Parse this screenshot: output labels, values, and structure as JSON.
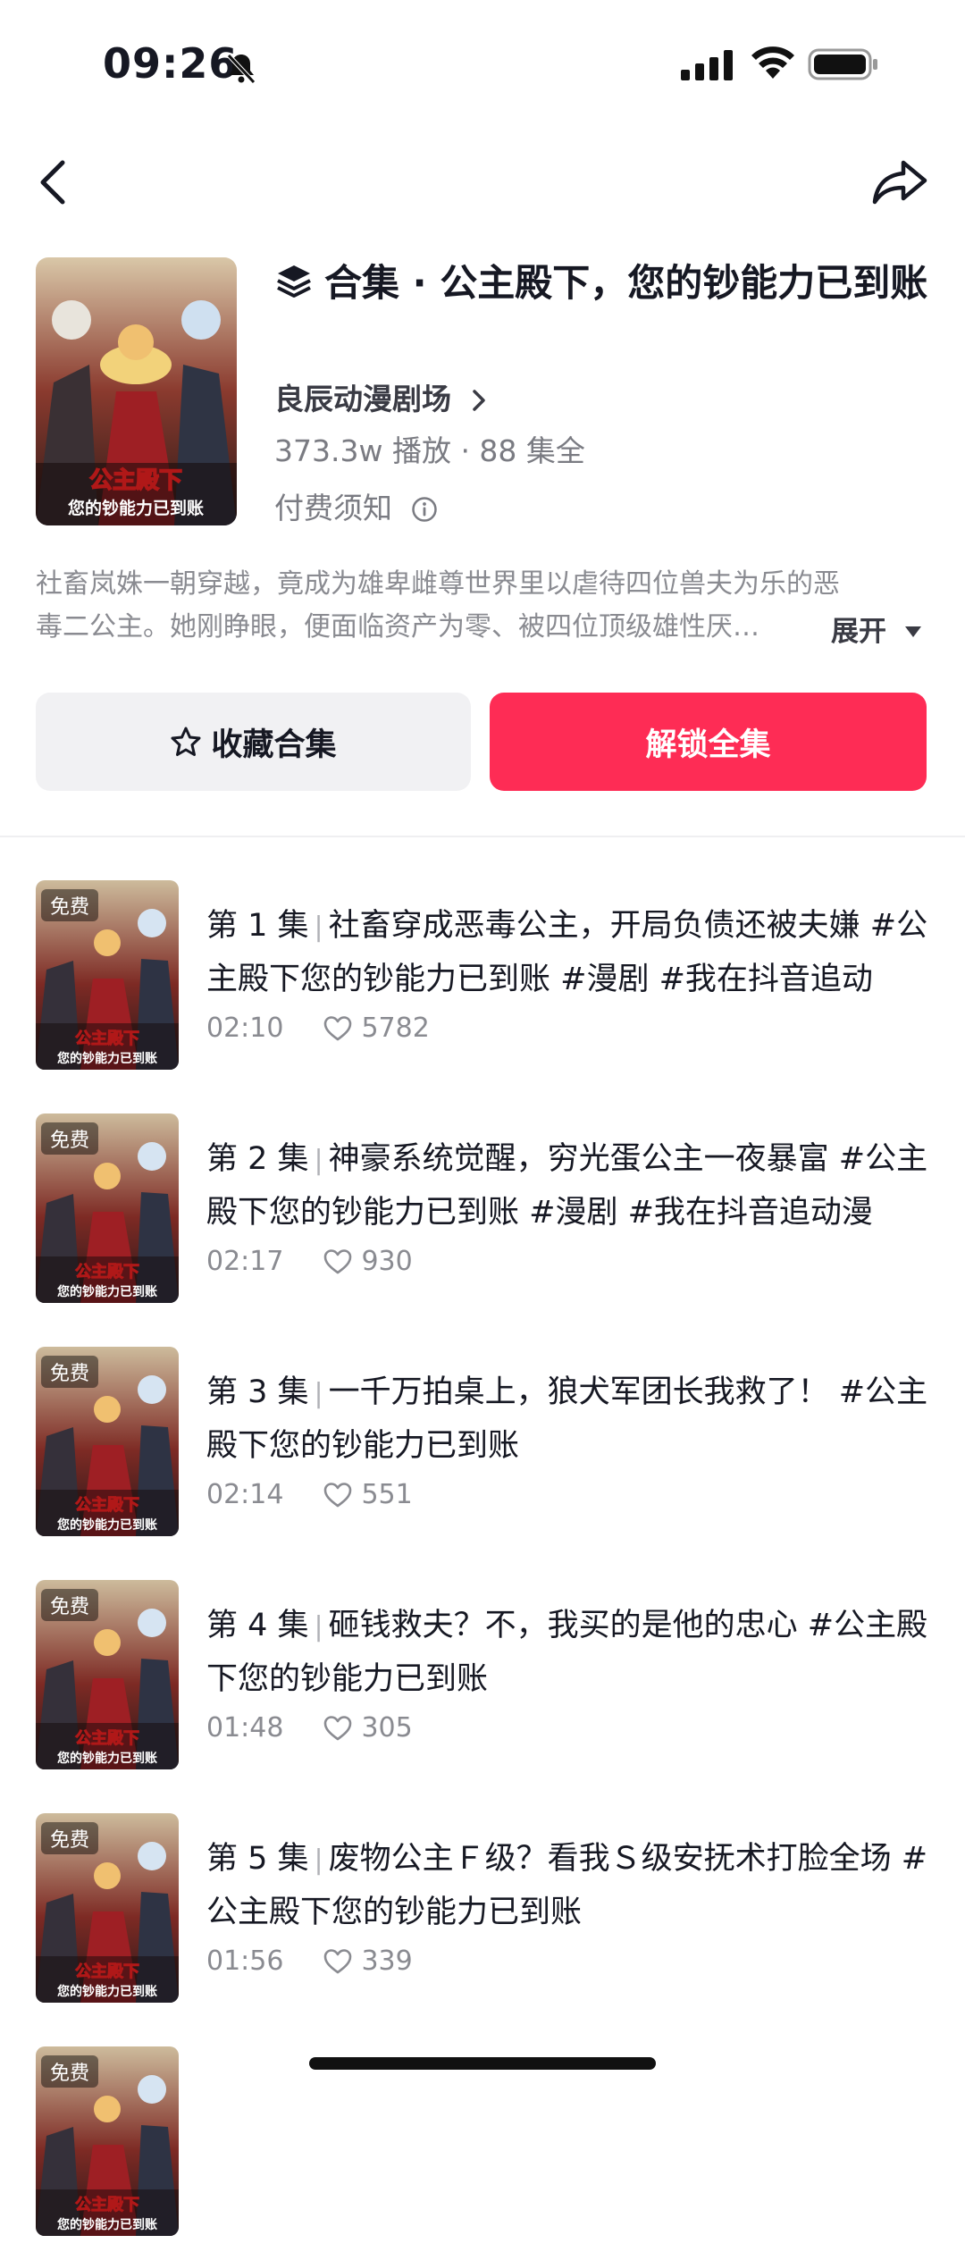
{
  "status_bar": {
    "time": "09:26"
  },
  "collection": {
    "title": "合集 · 公主殿下，您的钞能力已到账",
    "channel": "良辰动漫剧场",
    "stats": "373.3w 播放 · 88 集全",
    "pay_note": "付费须知",
    "description_line1": "社畜岚姝一朝穿越，竟成为雄卑雌尊世界里以虐待四位兽夫为乐的恶",
    "description_line2": "毒二公主。她刚睁眼，便面临资产为零、被四位顶级雄性厌…",
    "expand_label": "展开",
    "cover_text_line1": "公主殿下",
    "cover_text_line2": "您的钞能力已到账"
  },
  "actions": {
    "favorite_label": "收藏合集",
    "unlock_label": "解锁全集"
  },
  "episodes": [
    {
      "badge": "免费",
      "number": "第 1 集",
      "title": "社畜穿成恶毒公主，开局负债还被夫嫌 #公主殿下您的钞能力已到账 #漫剧 #我在抖音追动",
      "duration": "02:10",
      "likes": "5782"
    },
    {
      "badge": "免费",
      "number": "第 2 集",
      "title": "神豪系统觉醒，穷光蛋公主一夜暴富 #公主殿下您的钞能力已到账 #漫剧 #我在抖音追动漫",
      "duration": "02:17",
      "likes": "930"
    },
    {
      "badge": "免费",
      "number": "第 3 集",
      "title": "一千万拍桌上，狼犬军团长我救了！ #公主殿下您的钞能力已到账",
      "duration": "02:14",
      "likes": "551"
    },
    {
      "badge": "免费",
      "number": "第 4 集",
      "title": "砸钱救夫？不，我买的是他的忠心 #公主殿下您的钞能力已到账",
      "duration": "01:48",
      "likes": "305"
    },
    {
      "badge": "免费",
      "number": "第 5 集",
      "title": "废物公主Ｆ级？看我Ｓ级安抚术打脸全场 #公主殿下您的钞能力已到账",
      "duration": "01:56",
      "likes": "339"
    },
    {
      "badge": "免费"
    }
  ],
  "colors": {
    "accent": "#fe2c55",
    "text": "#161823",
    "muted": "#8a8b91"
  }
}
